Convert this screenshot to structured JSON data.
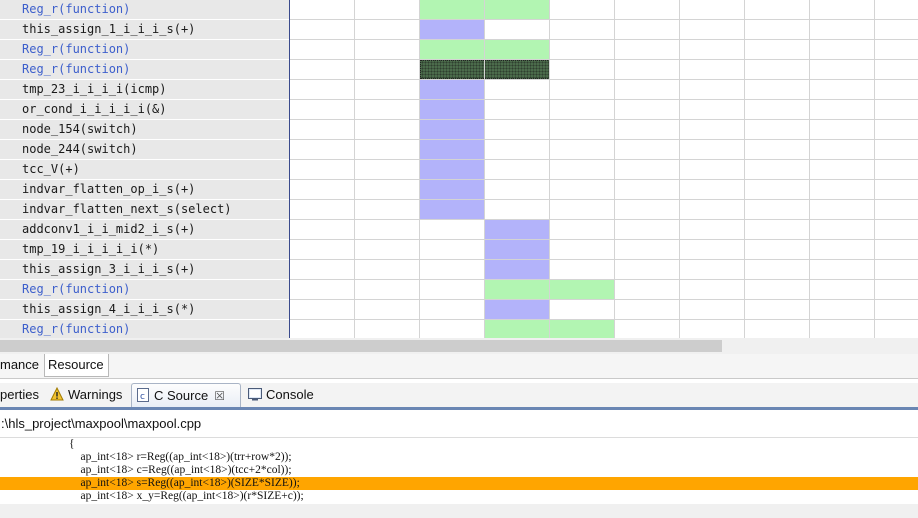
{
  "schedule": {
    "rows": [
      {
        "label": "Reg_r(function)",
        "fn": true,
        "bars": [
          {
            "start": 2,
            "span": 2,
            "kind": "green"
          }
        ]
      },
      {
        "label": "this_assign_1_i_i_i_s(+)",
        "fn": false,
        "bars": [
          {
            "start": 2,
            "span": 1,
            "kind": "blue"
          }
        ]
      },
      {
        "label": "Reg_r(function)",
        "fn": true,
        "bars": [
          {
            "start": 2,
            "span": 2,
            "kind": "green"
          }
        ]
      },
      {
        "label": "Reg_r(function)",
        "fn": true,
        "bars": [
          {
            "start": 2,
            "span": 2,
            "kind": "dark"
          }
        ]
      },
      {
        "label": "tmp_23_i_i_i_i(icmp)",
        "fn": false,
        "bars": [
          {
            "start": 2,
            "span": 1,
            "kind": "blue"
          }
        ]
      },
      {
        "label": "or_cond_i_i_i_i_i(&)",
        "fn": false,
        "bars": [
          {
            "start": 2,
            "span": 1,
            "kind": "blue"
          }
        ]
      },
      {
        "label": "node_154(switch)",
        "fn": false,
        "bars": [
          {
            "start": 2,
            "span": 1,
            "kind": "blue"
          }
        ]
      },
      {
        "label": "node_244(switch)",
        "fn": false,
        "bars": [
          {
            "start": 2,
            "span": 1,
            "kind": "blue"
          }
        ]
      },
      {
        "label": "tcc_V(+)",
        "fn": false,
        "bars": [
          {
            "start": 2,
            "span": 1,
            "kind": "blue"
          }
        ]
      },
      {
        "label": "indvar_flatten_op_i_s(+)",
        "fn": false,
        "bars": [
          {
            "start": 2,
            "span": 1,
            "kind": "blue"
          }
        ]
      },
      {
        "label": "indvar_flatten_next_s(select)",
        "fn": false,
        "bars": [
          {
            "start": 2,
            "span": 1,
            "kind": "blue"
          }
        ]
      },
      {
        "label": "addconv1_i_i_mid2_i_s(+)",
        "fn": false,
        "bars": [
          {
            "start": 3,
            "span": 1,
            "kind": "blue"
          }
        ]
      },
      {
        "label": "tmp_19_i_i_i_i_i(*)",
        "fn": false,
        "bars": [
          {
            "start": 3,
            "span": 1,
            "kind": "blue"
          }
        ]
      },
      {
        "label": "this_assign_3_i_i_i_s(+)",
        "fn": false,
        "bars": [
          {
            "start": 3,
            "span": 1,
            "kind": "blue"
          }
        ]
      },
      {
        "label": "Reg_r(function)",
        "fn": true,
        "bars": [
          {
            "start": 3,
            "span": 2,
            "kind": "green"
          }
        ]
      },
      {
        "label": "this_assign_4_i_i_i_s(*)",
        "fn": false,
        "bars": [
          {
            "start": 3,
            "span": 1,
            "kind": "blue"
          }
        ]
      },
      {
        "label": "Reg_r(function)",
        "fn": true,
        "bars": [
          {
            "start": 3,
            "span": 2,
            "kind": "green"
          }
        ]
      }
    ],
    "colors": {
      "green": "#b2f5b2",
      "blue": "#b3b3fa",
      "dark": "#4b6b4b",
      "fn_text": "#3d5fcc"
    }
  },
  "view_tabs": [
    {
      "label": "mance",
      "active": false
    },
    {
      "label": "Resource",
      "active": true
    }
  ],
  "panel_tabs": [
    {
      "label": "perties",
      "icon": "properties-icon",
      "active": false
    },
    {
      "label": "Warnings",
      "icon": "warning-icon",
      "active": false
    },
    {
      "label": "C Source",
      "icon": "c-file-icon",
      "active": true,
      "close": "☒"
    },
    {
      "label": "Console",
      "icon": "console-icon",
      "active": false
    }
  ],
  "source": {
    "path": ":\\hls_project\\maxpool\\maxpool.cpp",
    "lines": [
      {
        "text": "                        {",
        "highlight": false
      },
      {
        "text": "                            ap_int<18> r=Reg((ap_int<18>)(trr+row*2));",
        "highlight": false
      },
      {
        "text": "                            ap_int<18> c=Reg((ap_int<18>)(tcc+2*col));",
        "highlight": false
      },
      {
        "text": "                            ap_int<18> s=Reg((ap_int<18>)(SIZE*SIZE));",
        "highlight": true
      },
      {
        "text": "                            ap_int<18> x_y=Reg((ap_int<18>)(r*SIZE+c));",
        "highlight": false
      }
    ],
    "highlight_color": "#ffa500"
  }
}
